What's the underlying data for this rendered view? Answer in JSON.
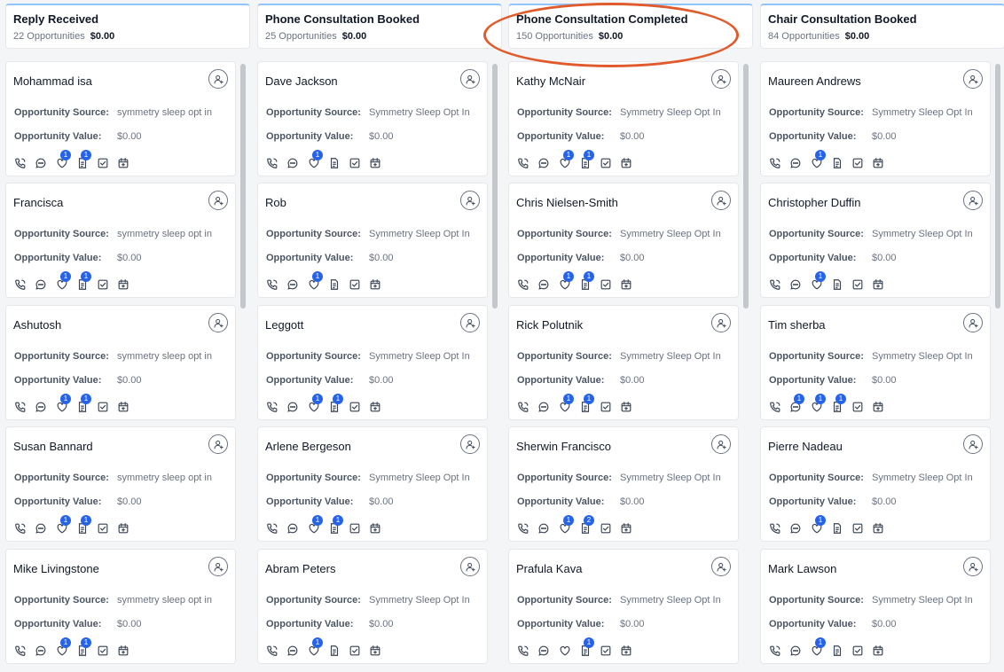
{
  "labels": {
    "source": "Opportunity Source:",
    "value": "Opportunity Value:"
  },
  "colors": {
    "accent": "#2563eb",
    "annotation": "#e05a2b"
  },
  "columns": [
    {
      "title": "Reply Received",
      "count": "22 Opportunities",
      "total": "$0.00",
      "cards": [
        {
          "name": "Mohammad isa",
          "source": "symmetry sleep opt in",
          "value": "$0.00",
          "badges": {
            "heart": "1",
            "note": "1"
          }
        },
        {
          "name": "Francisca",
          "source": "symmetry sleep opt in",
          "value": "$0.00",
          "badges": {
            "heart": "1",
            "note": "1"
          }
        },
        {
          "name": "Ashutosh",
          "source": "symmetry sleep opt in",
          "value": "$0.00",
          "badges": {
            "heart": "1",
            "note": "1"
          }
        },
        {
          "name": "Susan Bannard",
          "source": "symmetry sleep opt in",
          "value": "$0.00",
          "badges": {
            "heart": "1",
            "note": "1"
          }
        },
        {
          "name": "Mike Livingstone",
          "source": "symmetry sleep opt in",
          "value": "$0.00",
          "badges": {
            "heart": "1",
            "note": "1"
          }
        }
      ]
    },
    {
      "title": "Phone Consultation Booked",
      "count": "25 Opportunities",
      "total": "$0.00",
      "cards": [
        {
          "name": "Dave Jackson",
          "source": "Symmetry Sleep Opt In",
          "value": "$0.00",
          "badges": {
            "heart": "1"
          }
        },
        {
          "name": "Rob",
          "source": "Symmetry Sleep Opt In",
          "value": "$0.00",
          "badges": {
            "heart": "1"
          }
        },
        {
          "name": "Leggott",
          "source": "Symmetry Sleep Opt In",
          "value": "$0.00",
          "badges": {
            "heart": "1",
            "note": "1"
          }
        },
        {
          "name": "Arlene Bergeson",
          "source": "Symmetry Sleep Opt In",
          "value": "$0.00",
          "badges": {
            "heart": "1",
            "note": "1"
          }
        },
        {
          "name": "Abram Peters",
          "source": "Symmetry Sleep Opt In",
          "value": "$0.00",
          "badges": {
            "heart": "1"
          }
        }
      ]
    },
    {
      "title": "Phone Consultation Completed",
      "count": "150 Opportunities",
      "total": "$0.00",
      "cards": [
        {
          "name": "Kathy McNair",
          "source": "Symmetry Sleep Opt In",
          "value": "$0.00",
          "badges": {
            "heart": "1",
            "note": "1"
          }
        },
        {
          "name": "Chris Nielsen-Smith",
          "source": "Symmetry Sleep Opt In",
          "value": "$0.00",
          "badges": {
            "heart": "1",
            "note": "1"
          }
        },
        {
          "name": "Rick Polutnik",
          "source": "Symmetry Sleep Opt In",
          "value": "$0.00",
          "badges": {
            "heart": "1",
            "note": "1"
          }
        },
        {
          "name": "Sherwin Francisco",
          "source": "Symmetry Sleep Opt In",
          "value": "$0.00",
          "badges": {
            "heart": "1",
            "note": "2"
          }
        },
        {
          "name": "Prafula Kava",
          "source": "Symmetry Sleep Opt In",
          "value": "$0.00",
          "badges": {
            "note": "1"
          }
        }
      ]
    },
    {
      "title": "Chair Consultation Booked",
      "count": "84 Opportunities",
      "total": "$0.00",
      "cards": [
        {
          "name": "Maureen Andrews",
          "source": "Symmetry Sleep Opt In",
          "value": "$0.00",
          "badges": {
            "heart": "1"
          }
        },
        {
          "name": "Christopher Duffin",
          "source": "Symmetry Sleep Opt In",
          "value": "$0.00",
          "badges": {
            "heart": "1"
          }
        },
        {
          "name": "Tim sherba",
          "source": "Symmetry Sleep Opt In",
          "value": "$0.00",
          "badges": {
            "sms": "1",
            "heart": "1",
            "note": "1"
          }
        },
        {
          "name": "Pierre Nadeau",
          "source": "Symmetry Sleep Opt In",
          "value": "$0.00",
          "badges": {
            "heart": "1"
          }
        },
        {
          "name": "Mark Lawson",
          "source": "Symmetry Sleep Opt In",
          "value": "$0.00",
          "badges": {
            "heart": "1"
          }
        }
      ]
    }
  ]
}
